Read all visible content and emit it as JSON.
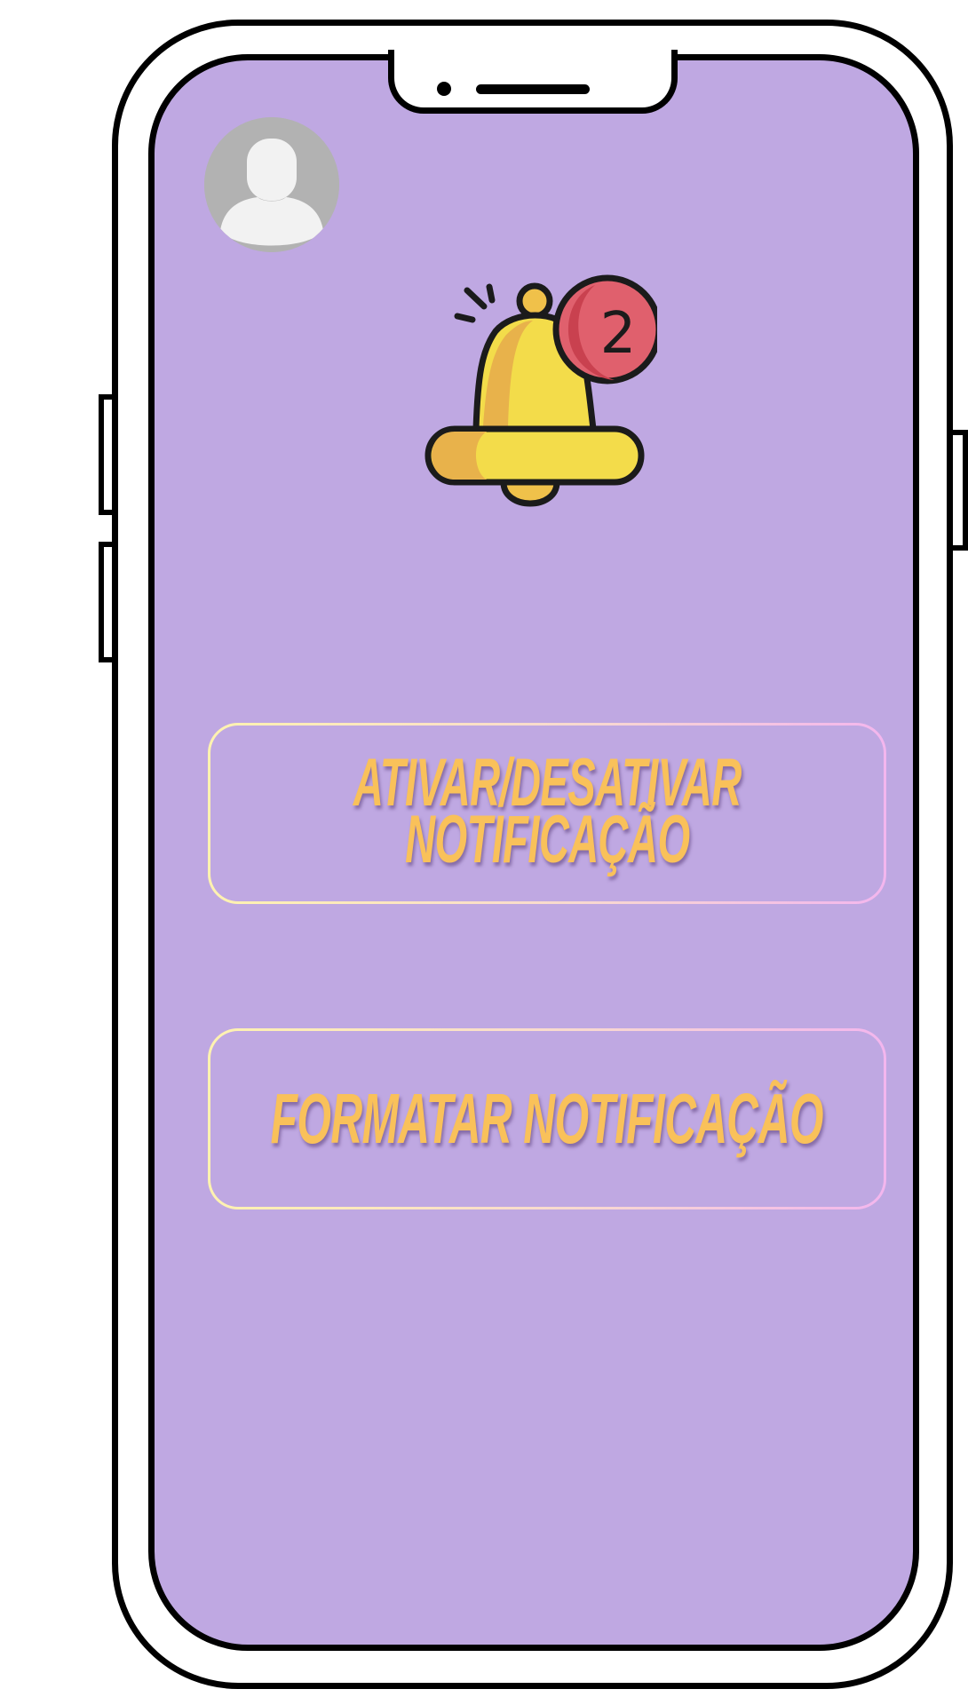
{
  "header": {
    "avatar_icon": "user-avatar-icon",
    "notification_icon": "bell-icon",
    "notification_count": "2"
  },
  "actions": {
    "toggle_label": "ATIVAR/DESATIVAR\nNOTIFICAÇÃO",
    "format_label": "FORMATAR NOTIFICAÇÃO"
  },
  "colors": {
    "screen_background": "#bfa8e2",
    "label_color": "#f9c15a",
    "bell_yellow": "#f3dc4a",
    "bell_shade": "#e8b24b",
    "badge_red": "#e0606d"
  }
}
